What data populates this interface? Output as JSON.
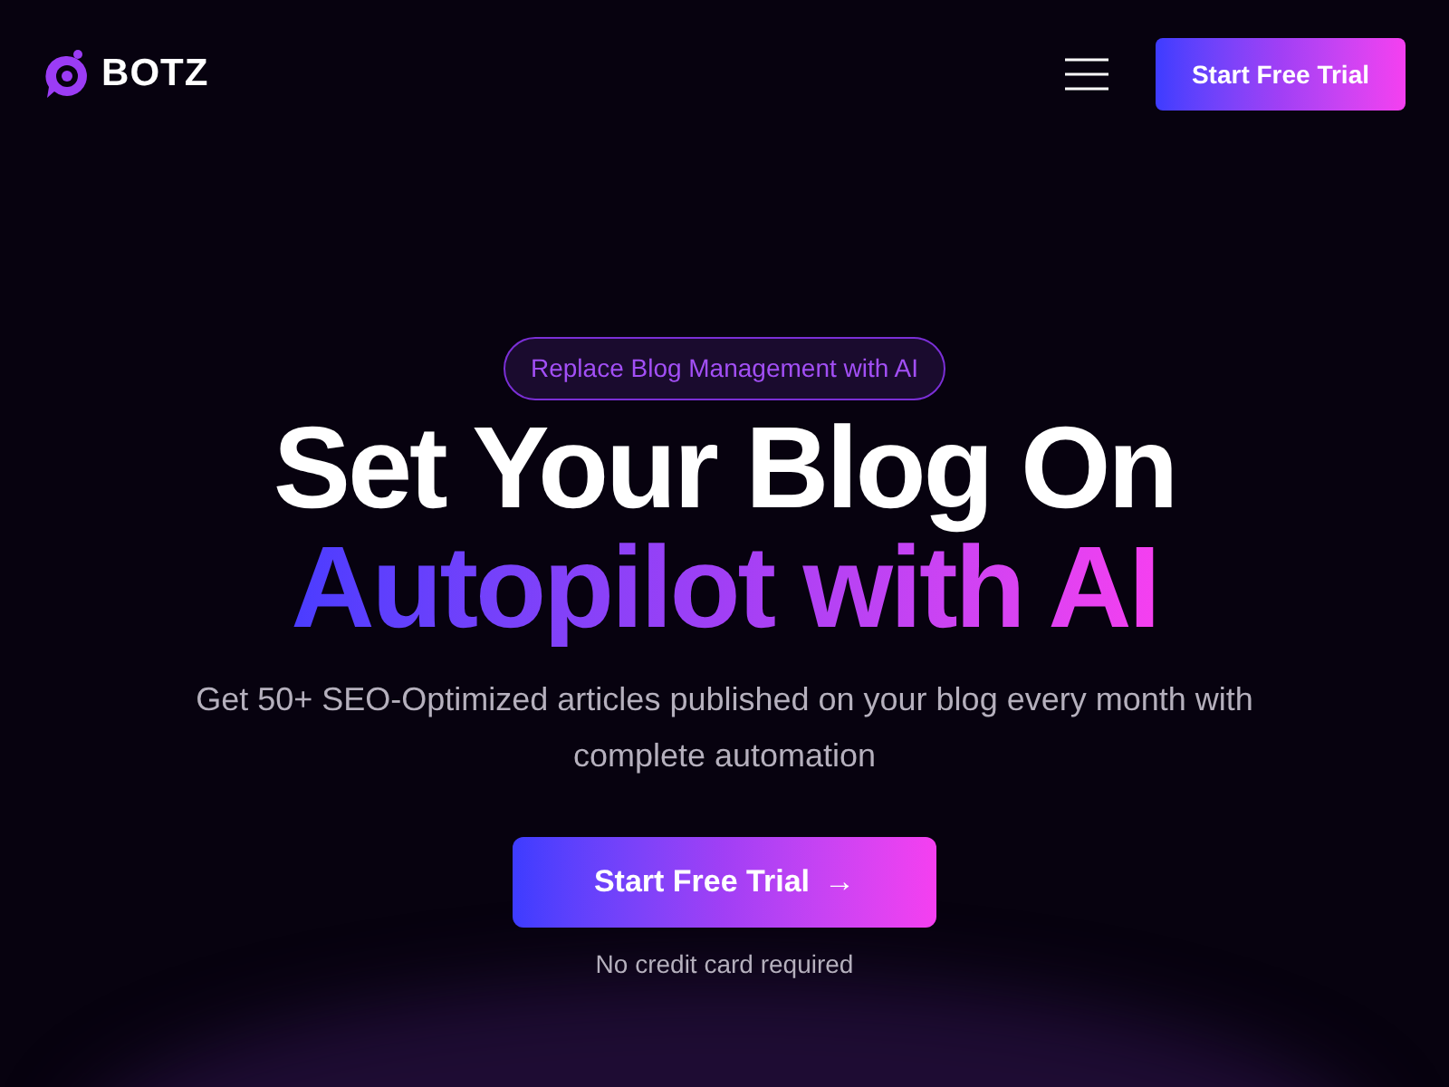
{
  "brand": {
    "name": "BOTZ"
  },
  "nav": {
    "cta": "Start Free Trial"
  },
  "hero": {
    "badge": "Replace Blog Management with AI",
    "headline_line_1": "Set Your Blog On",
    "headline_line_2": "Autopilot with AI",
    "subtitle": "Get 50+ SEO-Optimized articles published on your blog every month with complete automation",
    "cta": "Start Free Trial",
    "cta_arrow": "→",
    "note": "No credit card required"
  }
}
